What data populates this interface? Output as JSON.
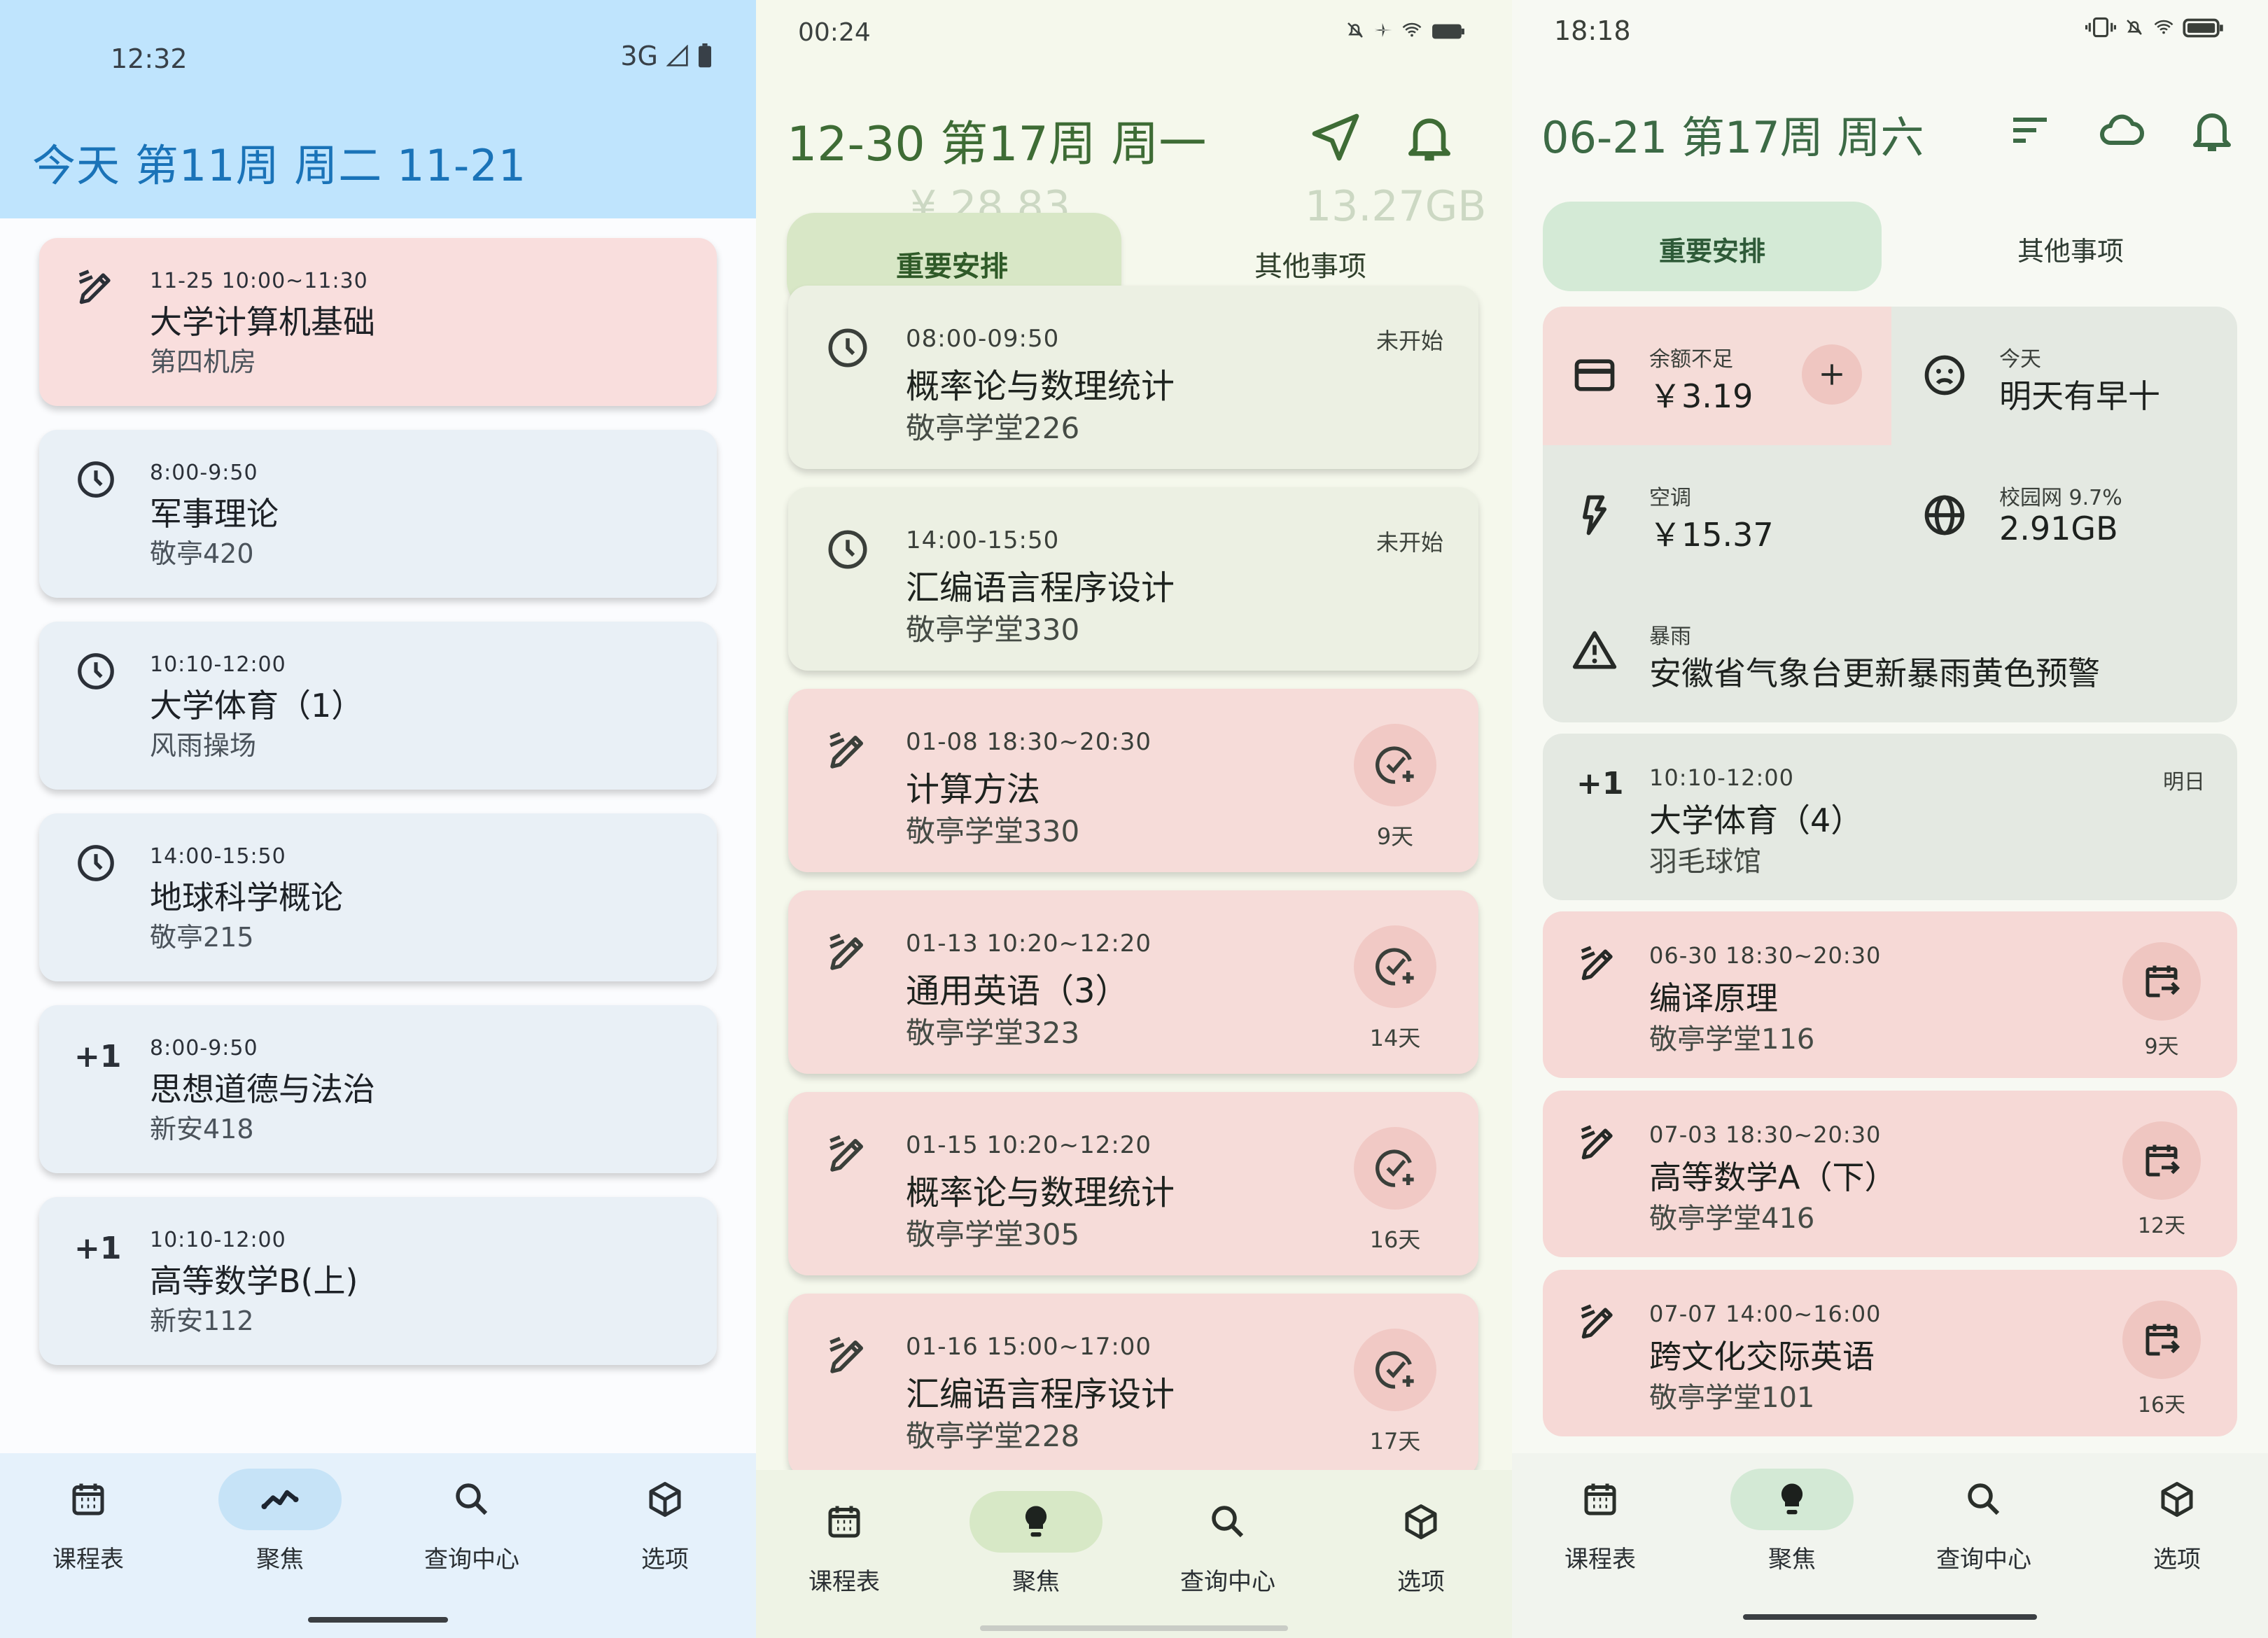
{
  "panel1": {
    "status_time": "12:32",
    "status_network": "3G",
    "title": "今天  第11周  周二  11-21",
    "cards": [
      {
        "type": "exam",
        "time": "11-25 10:00~11:30",
        "name": "大学计算机基础",
        "room": "第四机房"
      },
      {
        "type": "clock",
        "time": "8:00-9:50",
        "name": "军事理论",
        "room": "敬亭420"
      },
      {
        "type": "clock",
        "time": "10:10-12:00",
        "name": "大学体育（1）",
        "room": "风雨操场"
      },
      {
        "type": "clock",
        "time": "14:00-15:50",
        "name": "地球科学概论",
        "room": "敬亭215"
      },
      {
        "type": "plus",
        "plus": "+1",
        "time": "8:00-9:50",
        "name": "思想道德与法治",
        "room": "新安418"
      },
      {
        "type": "plus",
        "plus": "+1",
        "time": "10:10-12:00",
        "name": "高等数学B(上)",
        "room": "新安112"
      }
    ],
    "nav": [
      {
        "label": "课程表",
        "icon": "calendar-icon"
      },
      {
        "label": "聚焦",
        "icon": "trend-icon",
        "active": true
      },
      {
        "label": "查询中心",
        "icon": "search-icon"
      },
      {
        "label": "选项",
        "icon": "cube-icon"
      }
    ]
  },
  "panel2": {
    "status_time": "00:24",
    "title": "12-30 第17周 周一",
    "tab_important": "重要安排",
    "tab_other": "其他事项",
    "ghost": {
      "a": "¥ 28.83",
      "b": "13.27GB"
    },
    "cards": [
      {
        "type": "clock",
        "time": "08:00-09:50",
        "name": "概率论与数理统计",
        "room": "敬亭学堂226",
        "status": "未开始"
      },
      {
        "type": "clock",
        "time": "14:00-15:50",
        "name": "汇编语言程序设计",
        "room": "敬亭学堂330",
        "status": "未开始"
      },
      {
        "type": "exam",
        "time": "01-08 18:30~20:30",
        "name": "计算方法",
        "room": "敬亭学堂330",
        "days": "9天"
      },
      {
        "type": "exam",
        "time": "01-13 10:20~12:20",
        "name": "通用英语（3）",
        "room": "敬亭学堂323",
        "days": "14天"
      },
      {
        "type": "exam",
        "time": "01-15 10:20~12:20",
        "name": "概率论与数理统计",
        "room": "敬亭学堂305",
        "days": "16天"
      },
      {
        "type": "exam",
        "time": "01-16 15:00~17:00",
        "name": "汇编语言程序设计",
        "room": "敬亭学堂228",
        "days": "17天"
      }
    ],
    "nav": [
      {
        "label": "课程表",
        "icon": "calendar-icon"
      },
      {
        "label": "聚焦",
        "icon": "bulb-icon",
        "active": true
      },
      {
        "label": "查询中心",
        "icon": "search-icon"
      },
      {
        "label": "选项",
        "icon": "cube-icon"
      }
    ]
  },
  "panel3": {
    "status_time": "18:18",
    "title": "06-21 第17周 周六",
    "tab_important": "重要安排",
    "tab_other": "其他事项",
    "widgets": {
      "balance_label": "余额不足",
      "balance_value": "￥3.19",
      "today_label": "今天",
      "today_value": "明天有早十",
      "ac_label": "空调",
      "ac_value": "￥15.37",
      "net_label": "校园网 9.7%",
      "net_value": "2.91GB",
      "alert_label": "暴雨",
      "alert_value": "安徽省气象台更新暴雨黄色预警"
    },
    "cards": [
      {
        "type": "plus",
        "plus": "+1",
        "time": "10:10-12:00",
        "name": "大学体育（4）",
        "room": "羽毛球馆",
        "status": "明日"
      },
      {
        "type": "exam",
        "time": "06-30 18:30~20:30",
        "name": "编译原理",
        "room": "敬亭学堂116",
        "days": "9天"
      },
      {
        "type": "exam",
        "time": "07-03 18:30~20:30",
        "name": "高等数学A（下）",
        "room": "敬亭学堂416",
        "days": "12天"
      },
      {
        "type": "exam",
        "time": "07-07 14:00~16:00",
        "name": "跨文化交际英语",
        "room": "敬亭学堂101",
        "days": "16天"
      }
    ],
    "nav": [
      {
        "label": "课程表",
        "icon": "calendar-icon"
      },
      {
        "label": "聚焦",
        "icon": "bulb-icon",
        "active": true
      },
      {
        "label": "查询中心",
        "icon": "search-icon"
      },
      {
        "label": "选项",
        "icon": "cube-icon"
      }
    ]
  },
  "colors": {
    "blue_header": "#bfe4fd",
    "exam_red": "#f9dedd",
    "green_tab": "#d8e7c6"
  }
}
